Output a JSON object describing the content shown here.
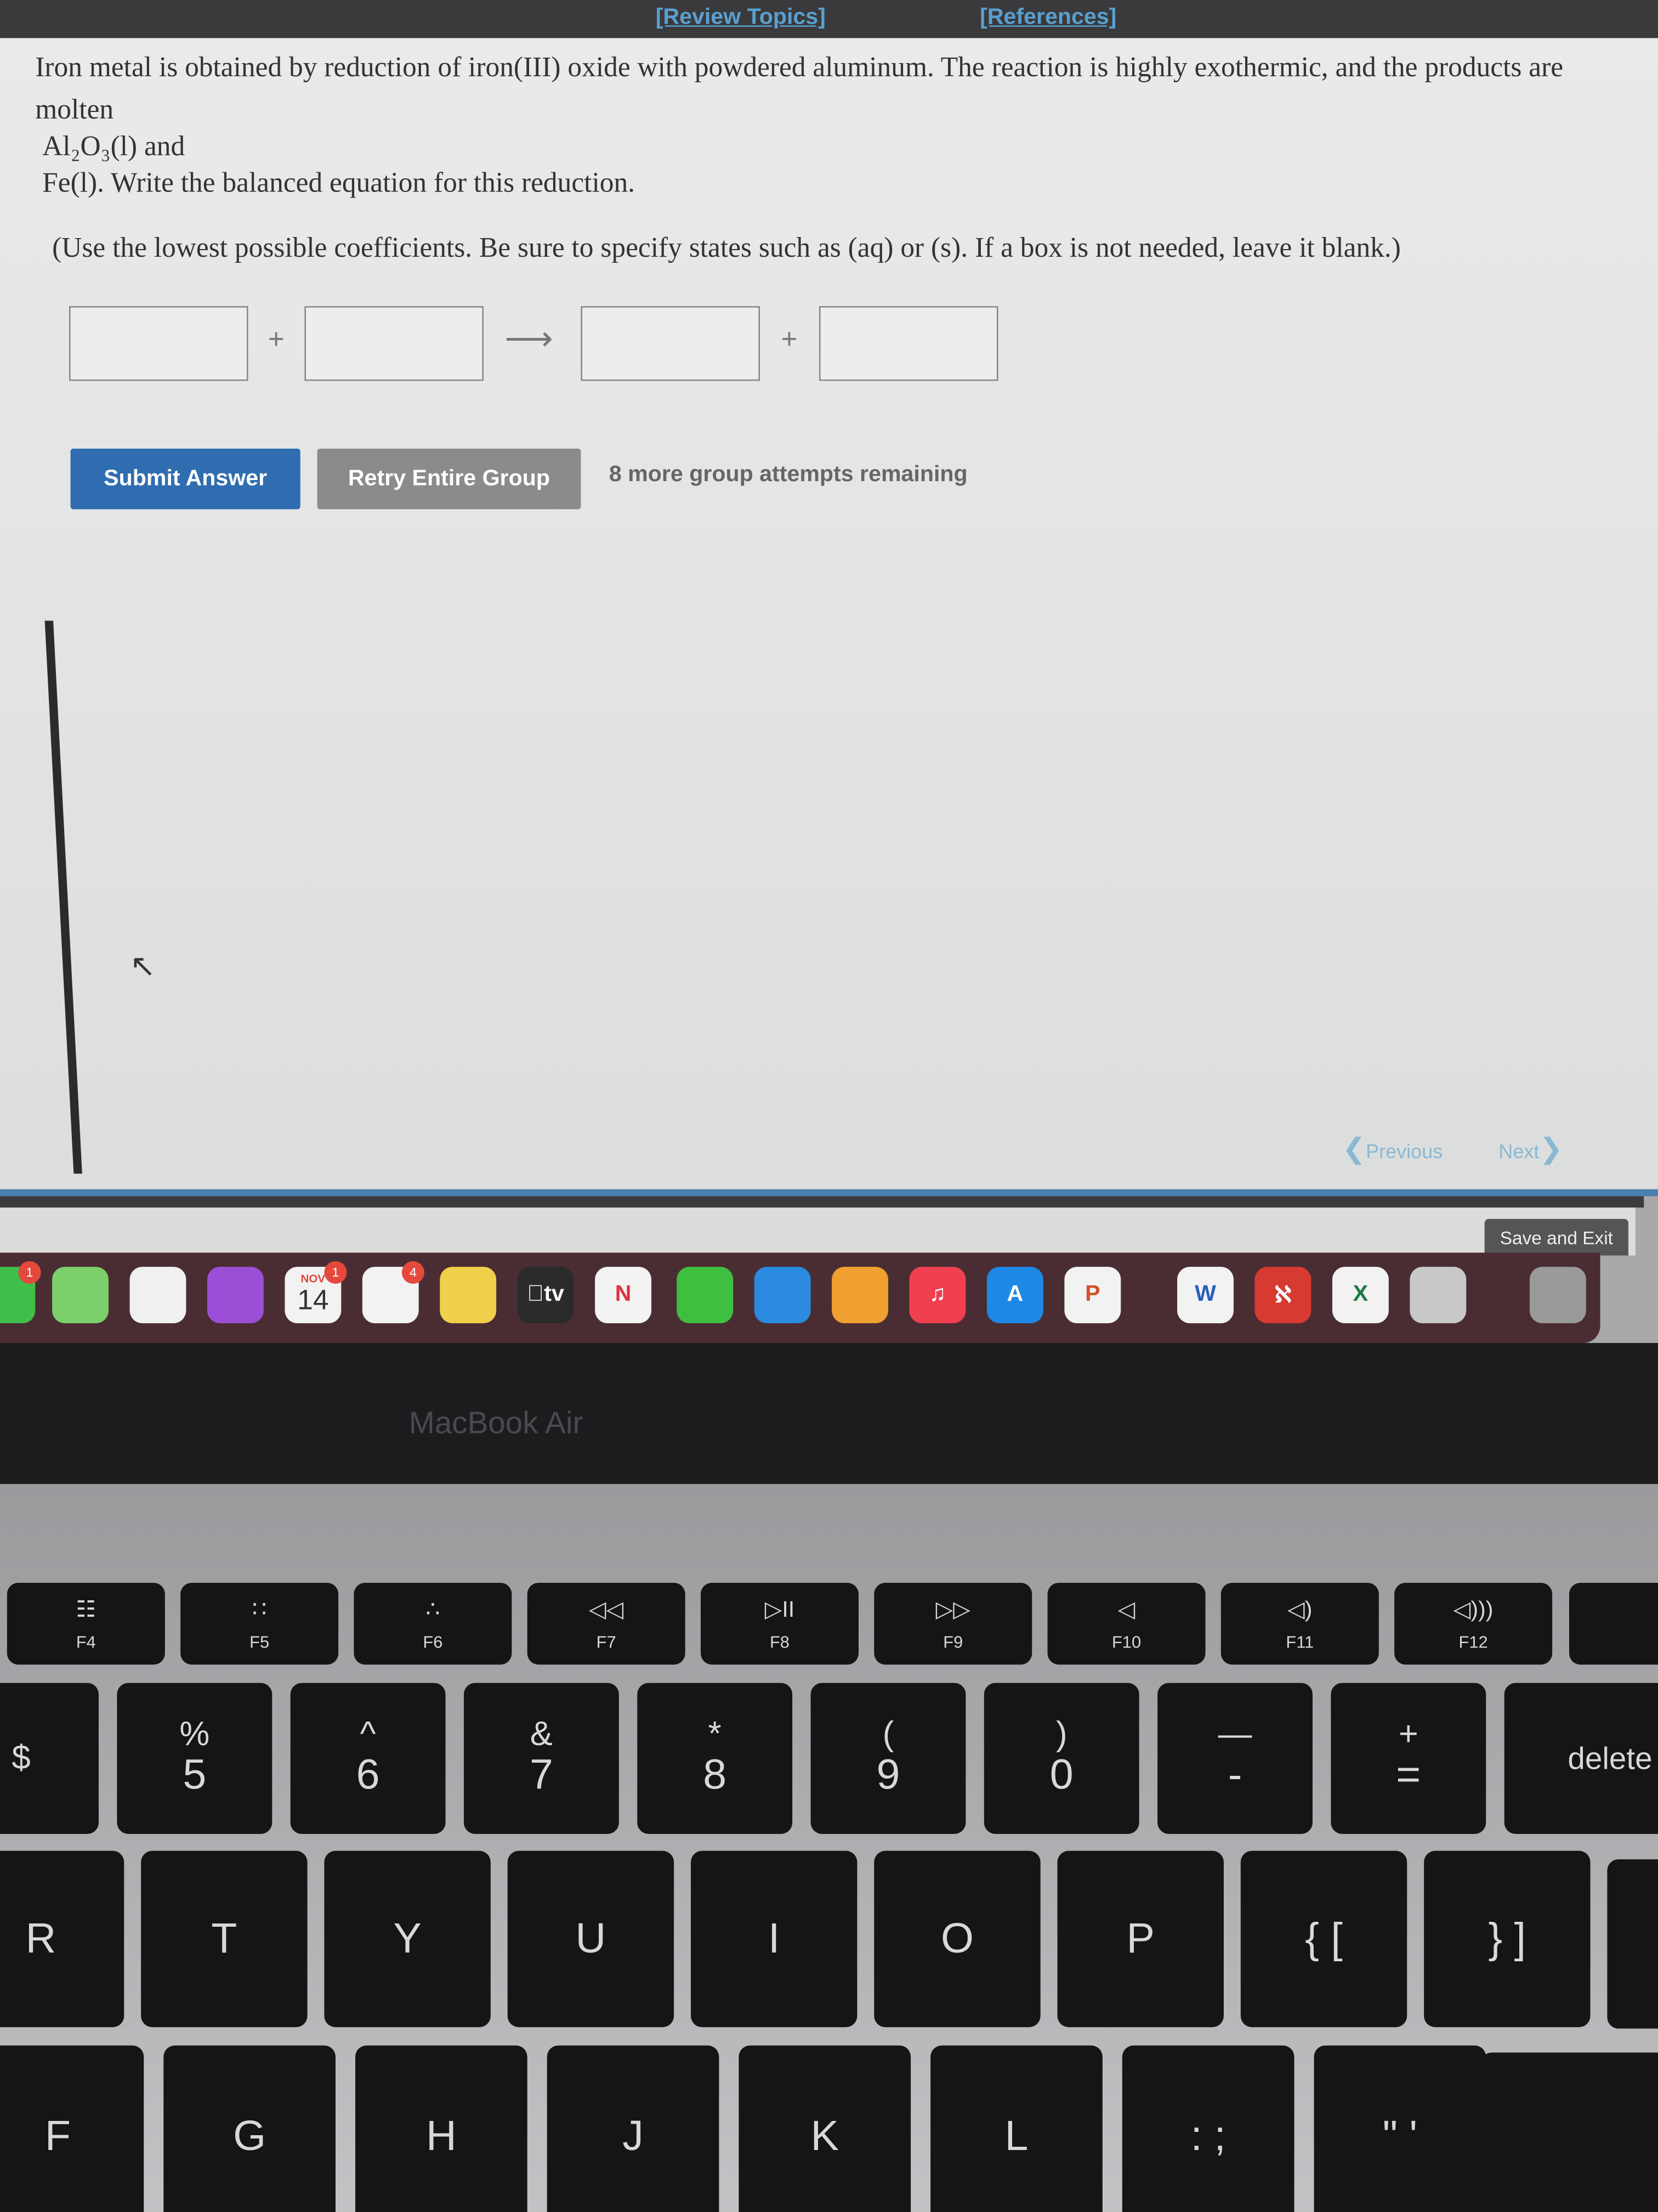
{
  "header": {
    "review_topics": "[Review Topics]",
    "references": "[References]"
  },
  "question": {
    "line1": "Iron metal is obtained by reduction of iron(III) oxide with powdered aluminum. The reaction is highly exothermic, and the products are",
    "line2": "molten",
    "line3": "Al₂O₃(l) and",
    "line4": "Fe(l). Write the balanced equation for this reduction.",
    "instructions": "(Use the lowest possible coefficients. Be sure to specify states such as (aq) or (s). If a box is not needed, leave it blank.)"
  },
  "equation": {
    "boxes": [
      "",
      "",
      "",
      ""
    ],
    "plus": "+",
    "arrow": "⟶"
  },
  "actions": {
    "submit": "Submit Answer",
    "retry": "Retry Entire Group",
    "attempts": "8 more group attempts remaining"
  },
  "nav": {
    "previous": "Previous",
    "next": "Next",
    "save_exit": "Save and Exit"
  },
  "colors": {
    "submit": "#2f6db0",
    "retry": "#8b8b8b",
    "link": "#5a9fd0",
    "dock": "#4a2d33"
  },
  "dock": {
    "items": [
      {
        "name": "facetime",
        "badge": "1",
        "label": ""
      },
      {
        "name": "maps",
        "label": ""
      },
      {
        "name": "photos",
        "label": ""
      },
      {
        "name": "podcasts",
        "label": ""
      },
      {
        "name": "calendar",
        "month": "NOV",
        "day": "14",
        "badge": "1"
      },
      {
        "name": "reminders",
        "badge": "4",
        "label": ""
      },
      {
        "name": "notes",
        "label": ""
      },
      {
        "name": "apple-tv",
        "label": "tv"
      },
      {
        "name": "news",
        "label": "N"
      },
      {
        "name": "numbers",
        "label": ""
      },
      {
        "name": "keynote",
        "label": ""
      },
      {
        "name": "pages",
        "label": ""
      },
      {
        "name": "music",
        "label": "♫"
      },
      {
        "name": "app-store",
        "label": "A"
      },
      {
        "name": "powerpoint",
        "label": "P"
      },
      {
        "name": "word",
        "label": "W"
      },
      {
        "name": "acrobat",
        "label": "ℵ"
      },
      {
        "name": "excel",
        "label": "X"
      },
      {
        "name": "preview",
        "label": ""
      },
      {
        "name": "trash",
        "label": ""
      }
    ]
  },
  "laptop": {
    "model": "MacBook Air"
  },
  "keyboard": {
    "fn": [
      {
        "g": "☷",
        "l": "F4"
      },
      {
        "g": "∷",
        "l": "F5"
      },
      {
        "g": "∴",
        "l": "F6"
      },
      {
        "g": "◁◁",
        "l": "F7"
      },
      {
        "g": "▷II",
        "l": "F8"
      },
      {
        "g": "▷▷",
        "l": "F9"
      },
      {
        "g": "◁",
        "l": "F10"
      },
      {
        "g": "◁)",
        "l": "F11"
      },
      {
        "g": "◁)))",
        "l": "F12"
      }
    ],
    "num": [
      {
        "t": "$",
        "b": ""
      },
      {
        "t": "%",
        "b": "5"
      },
      {
        "t": "^",
        "b": "6"
      },
      {
        "t": "&",
        "b": "7"
      },
      {
        "t": "*",
        "b": "8"
      },
      {
        "t": "(",
        "b": "9"
      },
      {
        "t": ")",
        "b": "0"
      },
      {
        "t": "—",
        "b": "-"
      },
      {
        "t": "+",
        "b": "="
      },
      {
        "t": "",
        "b": "delete"
      }
    ],
    "row1": [
      "R",
      "T",
      "Y",
      "U",
      "I",
      "O",
      "P",
      "{ [",
      "} ]"
    ],
    "row2": [
      "F",
      "G",
      "H",
      "J",
      "K",
      "L",
      ": ;",
      "\" '"
    ]
  }
}
